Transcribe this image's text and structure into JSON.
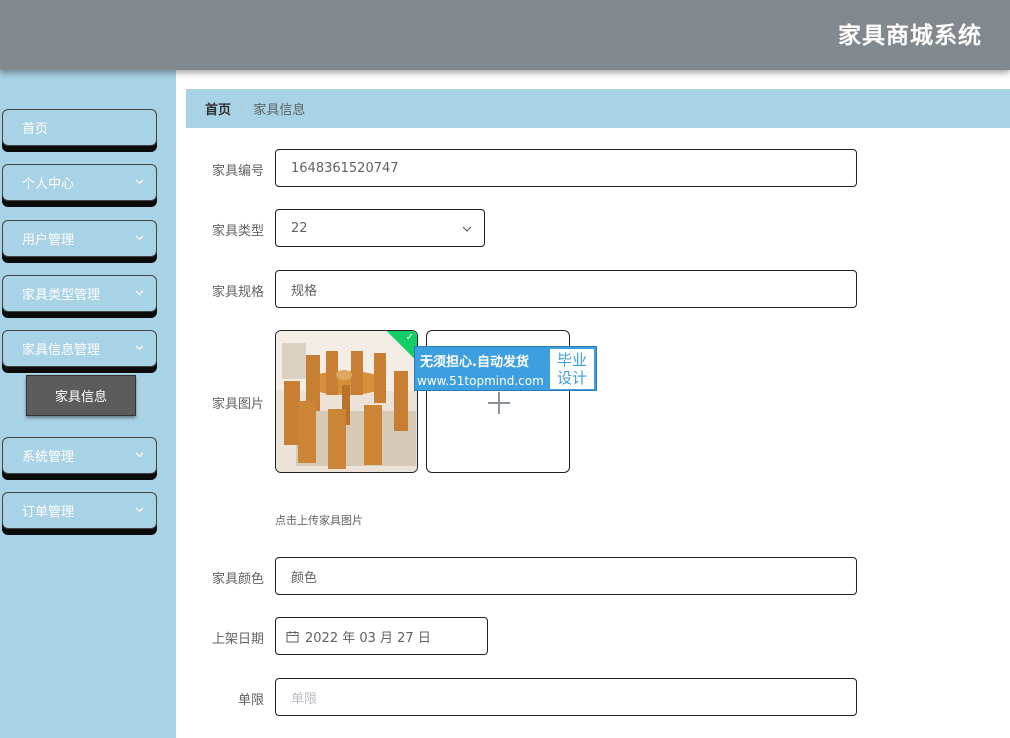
{
  "header": {
    "title": "家具商城系统"
  },
  "sidebar": {
    "items": [
      {
        "label": "首页"
      },
      {
        "label": "个人中心"
      },
      {
        "label": "用户管理"
      },
      {
        "label": "家具类型管理"
      },
      {
        "label": "家具信息管理"
      },
      {
        "label": "系统管理"
      },
      {
        "label": "订单管理"
      }
    ],
    "submenu": {
      "label": "家具信息"
    }
  },
  "breadcrumb": {
    "home": "首页",
    "separator": "/",
    "current": "家具信息"
  },
  "form": {
    "number": {
      "label": "家具编号",
      "value": "1648361520747"
    },
    "type": {
      "label": "家具类型",
      "value": "22"
    },
    "spec": {
      "label": "家具规格",
      "value": "规格"
    },
    "image": {
      "label": "家具图片",
      "tip": "点击上传家具图片"
    },
    "color": {
      "label": "家具颜色",
      "value": "颜色"
    },
    "date": {
      "label": "上架日期",
      "value": "2022 年 03 月 27 日"
    },
    "limit": {
      "label": "单限",
      "placeholder": "单限"
    }
  },
  "watermark": {
    "line1": "无须担心.自动发货",
    "line2": "www.51topmind.com",
    "box1": "毕业",
    "box2": "设计"
  },
  "colors": {
    "header": "#81898f",
    "sidebar": "#a8d2e5",
    "submenu": "#5c5c5c",
    "success": "#13ce66"
  }
}
